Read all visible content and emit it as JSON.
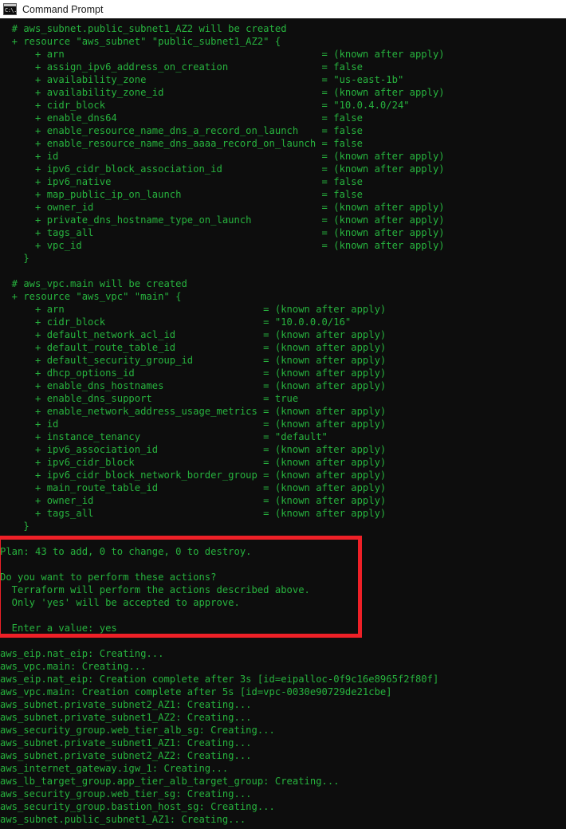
{
  "window": {
    "title": "Command Prompt",
    "icon": "command-prompt-icon",
    "icon_glyph": "C:\\.",
    "titlebar_bg": "#ffffff",
    "titlebar_fg": "#1a1a1a"
  },
  "terminal": {
    "background": "#0d0d0d",
    "foreground": "#27b33e",
    "font_size_px": 12,
    "line_height_px": 16
  },
  "annotation": {
    "type": "rectangle-highlight",
    "color": "#ee2027",
    "border_width_px": 5,
    "target": "terraform-apply-confirmation-prompt"
  },
  "console": {
    "blocks": [
      {
        "name": "aws_subnet.public_subnet1_AZ2",
        "comment": "  # aws_subnet.public_subnet1_AZ2 will be created",
        "resource_line": "  + resource \"aws_subnet\" \"public_subnet1_AZ2\" {",
        "close_line": "    }",
        "attributes": [
          {
            "key": "arn",
            "value": "(known after apply)"
          },
          {
            "key": "assign_ipv6_address_on_creation",
            "value": "false"
          },
          {
            "key": "availability_zone",
            "value": "\"us-east-1b\""
          },
          {
            "key": "availability_zone_id",
            "value": "(known after apply)"
          },
          {
            "key": "cidr_block",
            "value": "\"10.0.4.0/24\""
          },
          {
            "key": "enable_dns64",
            "value": "false"
          },
          {
            "key": "enable_resource_name_dns_a_record_on_launch",
            "value": "false"
          },
          {
            "key": "enable_resource_name_dns_aaaa_record_on_launch",
            "value": "false"
          },
          {
            "key": "id",
            "value": "(known after apply)"
          },
          {
            "key": "ipv6_cidr_block_association_id",
            "value": "(known after apply)"
          },
          {
            "key": "ipv6_native",
            "value": "false"
          },
          {
            "key": "map_public_ip_on_launch",
            "value": "false"
          },
          {
            "key": "owner_id",
            "value": "(known after apply)"
          },
          {
            "key": "private_dns_hostname_type_on_launch",
            "value": "(known after apply)"
          },
          {
            "key": "tags_all",
            "value": "(known after apply)"
          },
          {
            "key": "vpc_id",
            "value": "(known after apply)"
          }
        ]
      },
      {
        "name": "aws_vpc.main",
        "comment": "  # aws_vpc.main will be created",
        "resource_line": "  + resource \"aws_vpc\" \"main\" {",
        "close_line": "    }",
        "attributes": [
          {
            "key": "arn",
            "value": "(known after apply)"
          },
          {
            "key": "cidr_block",
            "value": "\"10.0.0.0/16\""
          },
          {
            "key": "default_network_acl_id",
            "value": "(known after apply)"
          },
          {
            "key": "default_route_table_id",
            "value": "(known after apply)"
          },
          {
            "key": "default_security_group_id",
            "value": "(known after apply)"
          },
          {
            "key": "dhcp_options_id",
            "value": "(known after apply)"
          },
          {
            "key": "enable_dns_hostnames",
            "value": "(known after apply)"
          },
          {
            "key": "enable_dns_support",
            "value": "true"
          },
          {
            "key": "enable_network_address_usage_metrics",
            "value": "(known after apply)"
          },
          {
            "key": "id",
            "value": "(known after apply)"
          },
          {
            "key": "instance_tenancy",
            "value": "\"default\""
          },
          {
            "key": "ipv6_association_id",
            "value": "(known after apply)"
          },
          {
            "key": "ipv6_cidr_block",
            "value": "(known after apply)"
          },
          {
            "key": "ipv6_cidr_block_network_border_group",
            "value": "(known after apply)"
          },
          {
            "key": "main_route_table_id",
            "value": "(known after apply)"
          },
          {
            "key": "owner_id",
            "value": "(known after apply)"
          },
          {
            "key": "tags_all",
            "value": "(known after apply)"
          }
        ]
      }
    ],
    "plan_summary": "Plan: 43 to add, 0 to change, 0 to destroy.",
    "plan_counts": {
      "add": 43,
      "change": 0,
      "destroy": 0
    },
    "confirmation": {
      "question": "Do you want to perform these actions?",
      "detail_line_1": "  Terraform will perform the actions described above.",
      "detail_line_2": "  Only 'yes' will be accepted to approve.",
      "prompt_label": "  Enter a value: ",
      "entered_value": "yes"
    },
    "apply_log": [
      "aws_eip.nat_eip: Creating...",
      "aws_vpc.main: Creating...",
      "aws_eip.nat_eip: Creation complete after 3s [id=eipalloc-0f9c16e8965f2f80f]",
      "aws_vpc.main: Creation complete after 5s [id=vpc-0030e90729de21cbe]",
      "aws_subnet.private_subnet2_AZ1: Creating...",
      "aws_subnet.private_subnet1_AZ2: Creating...",
      "aws_security_group.web_tier_alb_sg: Creating...",
      "aws_subnet.private_subnet1_AZ1: Creating...",
      "aws_subnet.private_subnet2_AZ2: Creating...",
      "aws_internet_gateway.igw_1: Creating...",
      "aws_lb_target_group.app_tier_alb_target_group: Creating...",
      "aws_security_group.web_tier_sg: Creating...",
      "aws_security_group.bastion_host_sg: Creating...",
      "aws_subnet.public_subnet1_AZ1: Creating..."
    ]
  }
}
